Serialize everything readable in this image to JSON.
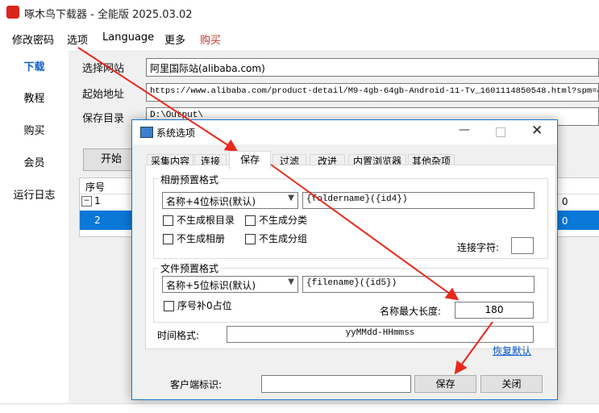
{
  "window": {
    "title": "啄木鸟下载器 - 全能版 2025.03.02"
  },
  "menu": {
    "items": [
      "修改密码",
      "选项",
      "Language",
      "更多",
      "购买"
    ],
    "buy_color": "#c0392b"
  },
  "sidebar": {
    "items": [
      "下载",
      "教程",
      "购买",
      "会员",
      "运行日志"
    ]
  },
  "form": {
    "site_label": "选择网站",
    "site_value": "阿里国际站(alibaba.com)",
    "url_label": "起始地址",
    "url_value": "https://www.alibaba.com/product-detail/M9-4gb-64gb-Android-11-Tv_1601114850548.html?spm=a2700",
    "dir_label": "保存目录",
    "dir_value": "D:\\Output\\",
    "start_button": "开始"
  },
  "grid": {
    "header": "序号",
    "rows": [
      {
        "no": "1",
        "right": ": 0"
      },
      {
        "no": "2",
        "right": ": 0"
      }
    ]
  },
  "dialog": {
    "title": "系统选项",
    "tabs": [
      "采集内容",
      "连接",
      "保存",
      "过滤",
      "改进",
      "内置浏览器",
      "其他杂项"
    ],
    "album_group": {
      "title": "相册预置格式",
      "combo": "名称+4位标识(默认)",
      "pattern": "{foldername}({id4})",
      "checks": [
        "不生成根目录",
        "不生成分类",
        "不生成相册",
        "不生成分组"
      ],
      "join_label": "连接字符:"
    },
    "file_group": {
      "title": "文件预置格式",
      "combo": "名称+5位标识(默认)",
      "pattern": "{filename}({id5})",
      "check": "序号补0占位",
      "maxlen_label": "名称最大长度:",
      "maxlen_value": "180"
    },
    "time_label": "时间格式:",
    "time_value": "yyMMdd-HHmmss",
    "restore_link": "恢复默认",
    "client_label": "客户端标识:",
    "save_button": "保存",
    "close_button": "关闭"
  },
  "annotation_color": "#e8291c"
}
